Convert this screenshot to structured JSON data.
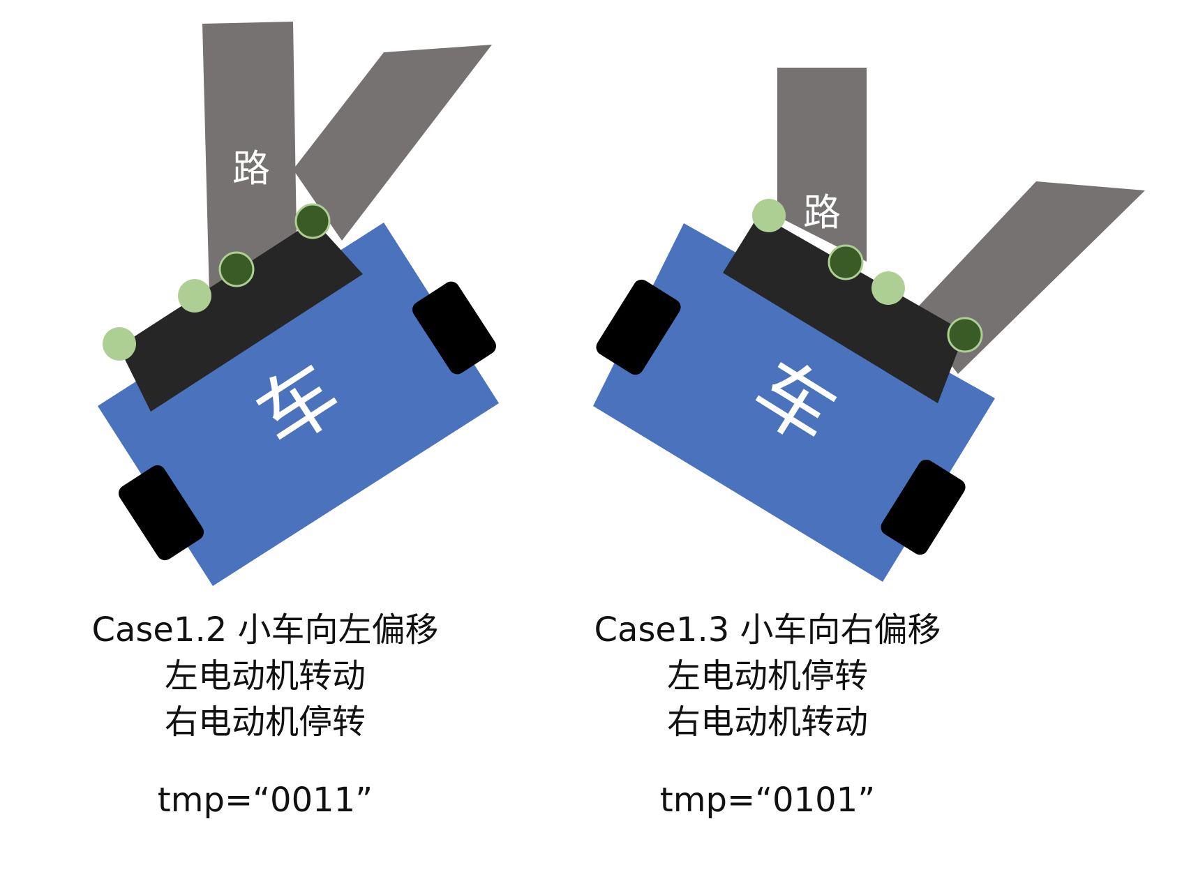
{
  "colors": {
    "road": "#767271",
    "car_body": "#4A72BD",
    "sensor_bar": "#262626",
    "wheel": "#000000",
    "sensor_off": "#AECF93",
    "sensor_on": "#3A5A26",
    "sensor_on_ring": "#AECF93",
    "label_text": "#ffffff"
  },
  "panels": [
    {
      "road_label": "路",
      "car_label": "车",
      "sensor_states": [
        "off",
        "off",
        "on",
        "on"
      ],
      "caption": {
        "title": "Case1.2 小车向左偏移",
        "left_motor": "左电动机转动",
        "right_motor": "右电动机停转",
        "tmp": "tmp=“0011”"
      }
    },
    {
      "road_label": "路",
      "car_label": "车",
      "sensor_states": [
        "off",
        "on",
        "off",
        "on"
      ],
      "caption": {
        "title": "Case1.3 小车向右偏移",
        "left_motor": "左电动机停转",
        "right_motor": "右电动机转动",
        "tmp": "tmp=“0101”"
      }
    }
  ]
}
